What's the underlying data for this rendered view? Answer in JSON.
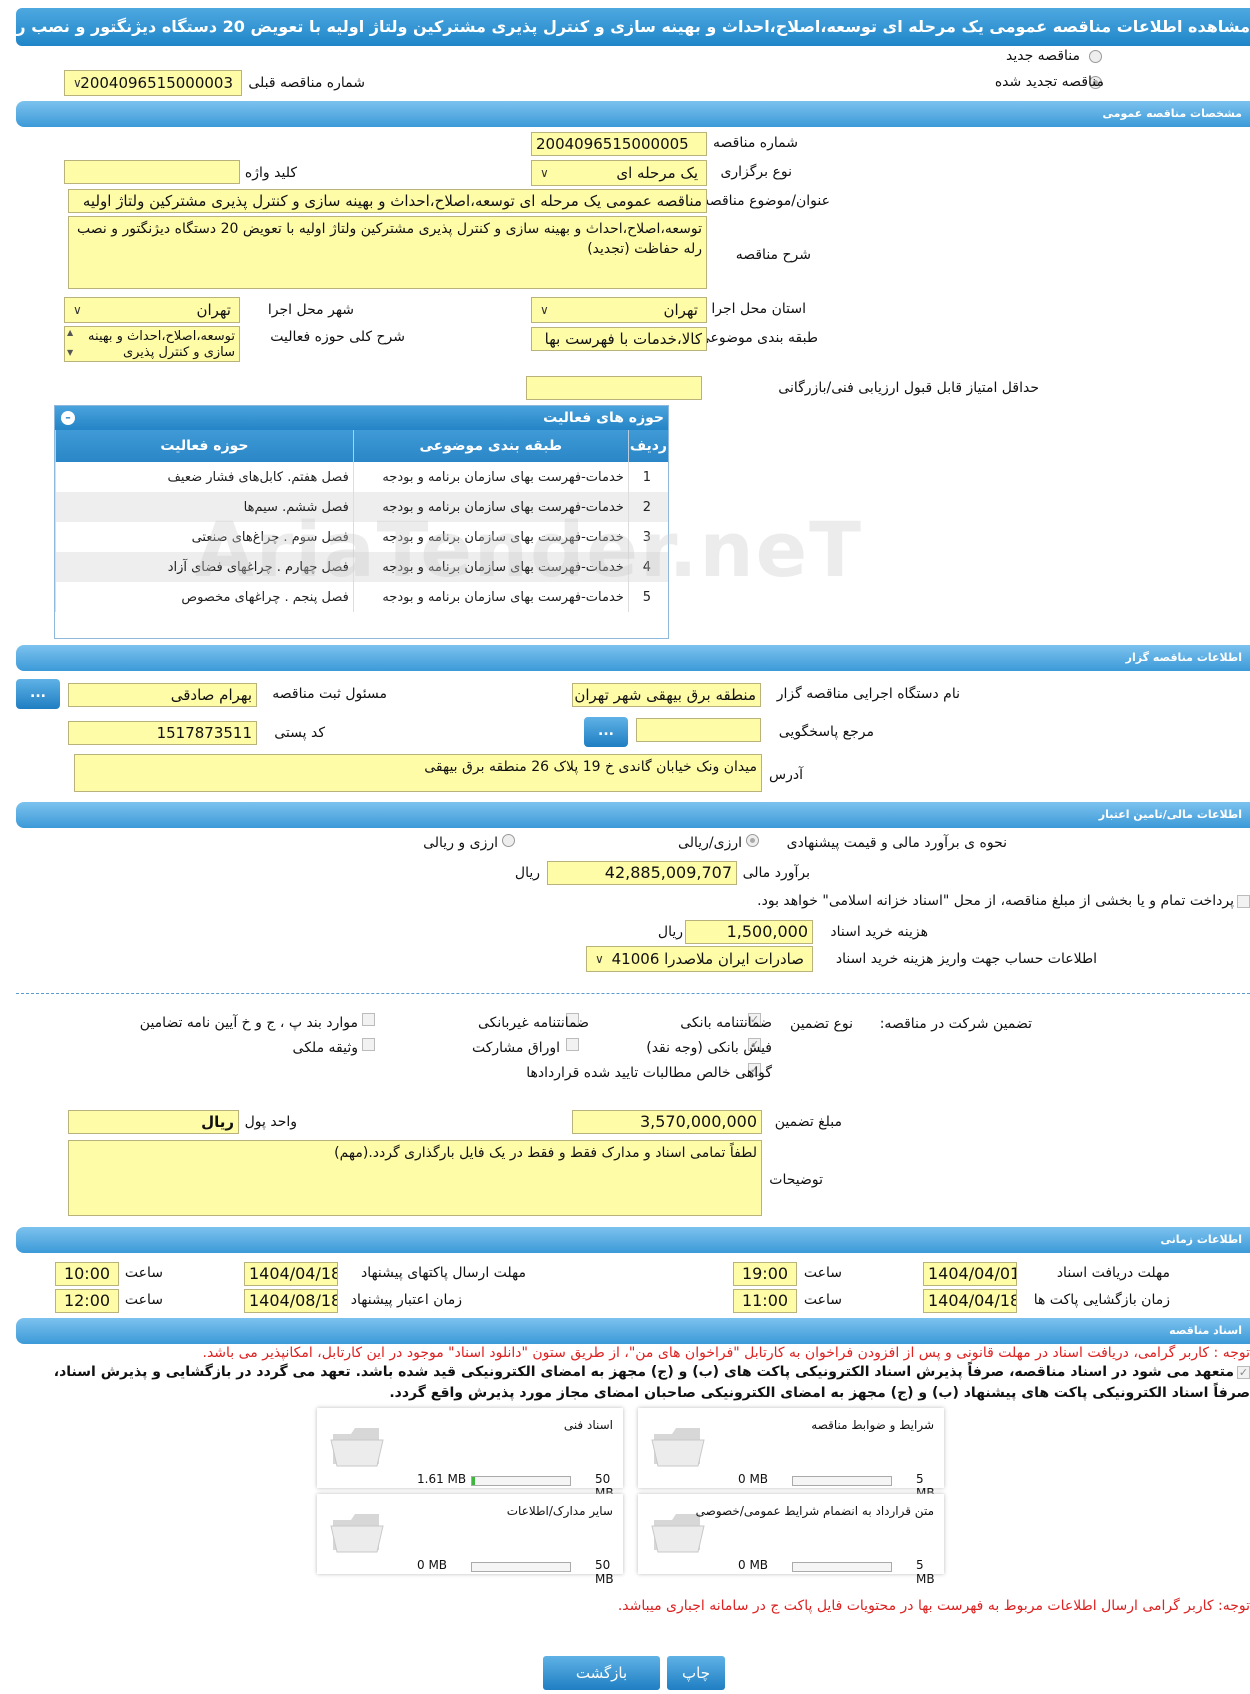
{
  "title": "مشاهده اطلاعات مناقصه عمومی یک مرحله ای توسعه،اصلاح،احداث و بهینه سازی و کنترل پذیری مشترکین ولتاژ اولیه با تعویض 20 دستگاه دیژنگتور و نصب رله حفاظت (تجدید)",
  "top": {
    "new_tender": "مناقصه جدید",
    "renewed_tender": "مناقصه تجدید شده",
    "prev_number_label": "شماره مناقصه قبلی",
    "prev_number": "2004096515000003"
  },
  "sections": {
    "general": "مشخصات مناقصه عمومی",
    "organizer": "اطلاعات مناقصه گزار",
    "finance": "اطلاعات مالی/تامین اعتبار",
    "timing": "اطلاعات زمانی",
    "docs": "اسناد مناقصه"
  },
  "general": {
    "number_label": "شماره مناقصه",
    "number": "2004096515000005",
    "type_label": "نوع برگزاری",
    "type": "یک مرحله ای",
    "keyword_label": "کلید واژه",
    "keyword": "",
    "subject_label": "عنوان/موضوع مناقصه",
    "subject": "مناقصه عمومی یک مرحله ای توسعه،اصلاح،احداث و بهینه سازی و کنترل پذیری مشترکین ولتاژ اولیه",
    "desc_label": "شرح مناقصه",
    "desc": "توسعه،اصلاح،احداث و بهینه سازی و کنترل پذیری مشترکین ولتاژ اولیه با تعویض 20 دستگاه دیژنگتور و نصب رله حفاظت (تجدید)",
    "province_label": "استان محل اجرا",
    "province": "تهران",
    "city_label": "شهر محل اجرا",
    "city": "تهران",
    "category_label": "طبقه بندی موضوعی",
    "category": "کالا،خدمات با فهرست بها",
    "scope_label": "شرح کلی حوزه فعالیت",
    "scope": "توسعه،اصلاح،احداث و بهینه سازی و کنترل پذیری",
    "min_score_label": "حداقل امتیاز قابل قبول ارزیابی فنی/بازرگانی",
    "min_score": ""
  },
  "activities": {
    "title": "حوزه های فعالیت",
    "headers": [
      "ردیف",
      "طبقه بندی موضوعی",
      "حوزه فعالیت"
    ],
    "rows": [
      [
        "1",
        "خدمات-فهرست بهای سازمان برنامه و بودجه",
        "فصل هفتم. کابل‌های فشار ضعیف"
      ],
      [
        "2",
        "خدمات-فهرست بهای سازمان برنامه و بودجه",
        "فصل ششم. سیم‌ها"
      ],
      [
        "3",
        "خدمات-فهرست بهای سازمان برنامه و بودجه",
        "فصل سوم . چراغ‌های صنعتی"
      ],
      [
        "4",
        "خدمات-فهرست بهای سازمان برنامه و بودجه",
        "فصل چهارم . چراغهای فضای آزاد"
      ],
      [
        "5",
        "خدمات-فهرست بهای سازمان برنامه و بودجه",
        "فصل پنجم . چراغهای مخصوص"
      ]
    ]
  },
  "organizer": {
    "org_label": "نام دستگاه اجرایی مناقصه گزار",
    "org": "منطقه برق بیهقی شهر تهران",
    "owner_label": "مسئول ثبت مناقصه",
    "owner": "بهرام صادقی",
    "ref_label": "مرجع پاسخگویی",
    "ref": "",
    "postal_label": "کد پستی",
    "postal": "1517873511",
    "address_label": "آدرس",
    "address": "میدان ونک خیابان گاندی خ 19 پلاک 26 منطقه برق بیهقی",
    "dots": "..."
  },
  "finance": {
    "method_label": "نحوه ی برآورد مالی و قیمت پیشنهادی",
    "opt1": "ارزی/ریالی",
    "opt2": "ارزی و ریالی",
    "estimate_label": "برآورد مالی",
    "estimate": "42,885,009,707",
    "rial": "ریال",
    "treasury": "پرداخت تمام و یا بخشی از مبلغ مناقصه، از محل \"اسناد خزانه اسلامی\" خواهد بود.",
    "doc_fee_label": "هزینه خرید اسناد",
    "doc_fee": "1,500,000",
    "account_label": "اطلاعات حساب جهت واریز هزینه خرید اسناد",
    "account": "صادرات ایران ملاصدرا 41006"
  },
  "guarantee": {
    "label": "تضمین شرکت در مناقصه:",
    "type_label": "نوع تضمین",
    "options": [
      "ضمانتنامه بانکی",
      "ضمانتنامه غیربانکی",
      "موارد بند پ ، ج و خ آیین نامه تضامین",
      "فیش بانکی (وجه نقد)",
      "اوراق مشارکت",
      "وثیقه ملکی",
      "گواهی خالص مطالبات تایید شده قراردادها"
    ],
    "amount_label": "مبلغ تضمین",
    "amount": "3,570,000,000",
    "currency_label": "واحد پول",
    "currency": "ریال",
    "notes_label": "توضیحات",
    "notes": "لطفاً تمامی اسناد و مدارک فقط و فقط در یک فایل بارگذاری گردد.(مهم)"
  },
  "timing": {
    "receive_label": "مهلت دریافت اسناد",
    "receive_date": "1404/04/01",
    "receive_time_label": "ساعت",
    "receive_time": "19:00",
    "send_label": "مهلت ارسال پاکتهای پیشنهاد",
    "send_date": "1404/04/18",
    "send_time_label": "ساعت",
    "send_time": "10:00",
    "open_label": "زمان بازگشایی پاکت ها",
    "open_date": "1404/04/18",
    "open_time_label": "ساعت",
    "open_time": "11:00",
    "valid_label": "زمان اعتبار پیشنهاد",
    "valid_date": "1404/08/18",
    "valid_time_label": "ساعت",
    "valid_time": "12:00"
  },
  "docs": {
    "note1": "توجه : کاربر گرامی، دریافت اسناد در مهلت قانونی و پس از افزودن فراخوان به کارتابل \"فراخوان های من\"، از طریق ستون \"دانلود اسناد\" موجود در این کارتابل، امکانپذیر می باشد.",
    "commit1": "متعهد می شود در اسناد مناقصه، صرفاً پذیرش اسناد الکترونیکی پاکت های (ب) و (ج) مجهز به امضای الکترونیکی قید شده باشد. تعهد می گردد در بازگشایی و پذیرش اسناد،",
    "commit2": "صرفاً اسناد الکترونیکی پاکت های پیشنهاد (ب) و (ج) مجهز به امضای الکترونیکی صاحبان امضای مجاز مورد پذیرش واقع گردد.",
    "cards": [
      {
        "name": "شرایط و ضوابط مناقصه",
        "used": "0 MB",
        "max": "5 MB",
        "fill": 0
      },
      {
        "name": "اسناد فنی",
        "used": "1.61 MB",
        "max": "50 MB",
        "fill": 0.032
      },
      {
        "name": "متن قرارداد به انضمام شرایط عمومی/خصوصی",
        "used": "0 MB",
        "max": "5 MB",
        "fill": 0
      },
      {
        "name": "سایر مدارک/اطلاعات",
        "used": "0 MB",
        "max": "50 MB",
        "fill": 0
      }
    ],
    "note2": "توجه: کاربر گرامی ارسال اطلاعات مربوط به فهرست بها در محتویات فایل پاکت ج در سامانه اجباری میباشد."
  },
  "buttons": {
    "print": "چاپ",
    "back": "بازگشت"
  },
  "watermark": "AriaTender.neT"
}
